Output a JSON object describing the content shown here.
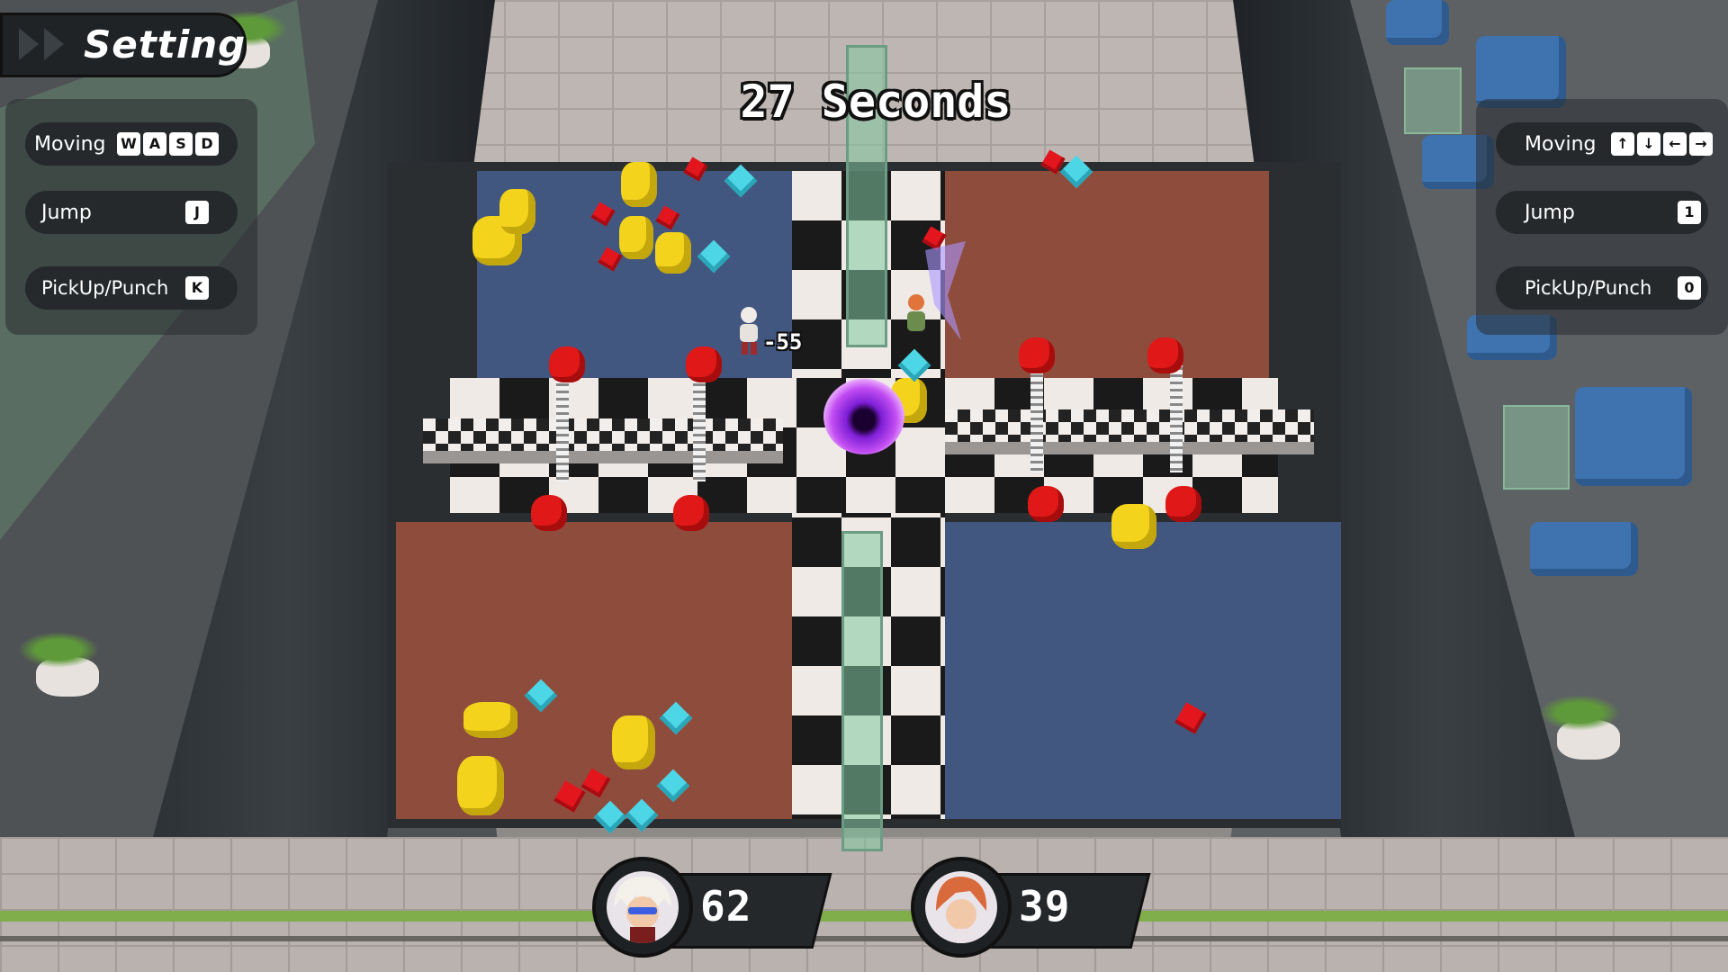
{
  "hud": {
    "setting_label": "Setting",
    "timer_text": "27 Seconds",
    "damage_popup": "-55"
  },
  "player1_controls": {
    "moving_label": "Moving",
    "moving_keys": [
      "W",
      "A",
      "S",
      "D"
    ],
    "jump_label": "Jump",
    "jump_key": "J",
    "pickup_label": "PickUp/Punch",
    "pickup_key": "K"
  },
  "player2_controls": {
    "moving_label": "Moving",
    "moving_keys": [
      "↑",
      "↓",
      "←",
      "→"
    ],
    "jump_label": "Jump",
    "jump_key": "1",
    "pickup_label": "PickUp/Punch",
    "pickup_key": "0"
  },
  "scores": {
    "player1": {
      "score": "62",
      "avatar": "white-haired-sunglasses-avatar"
    },
    "player2": {
      "score": "39",
      "avatar": "red-haired-avatar"
    }
  },
  "colors": {
    "blue_zone": "#42577f",
    "red_zone": "#8e4c3c",
    "hud_dark": "#25292c",
    "gem_yellow": "#f3d31c",
    "gem_cyan": "#4dd6e6",
    "gem_red": "#e3161e",
    "portal_purple": "#7d1ed6"
  }
}
